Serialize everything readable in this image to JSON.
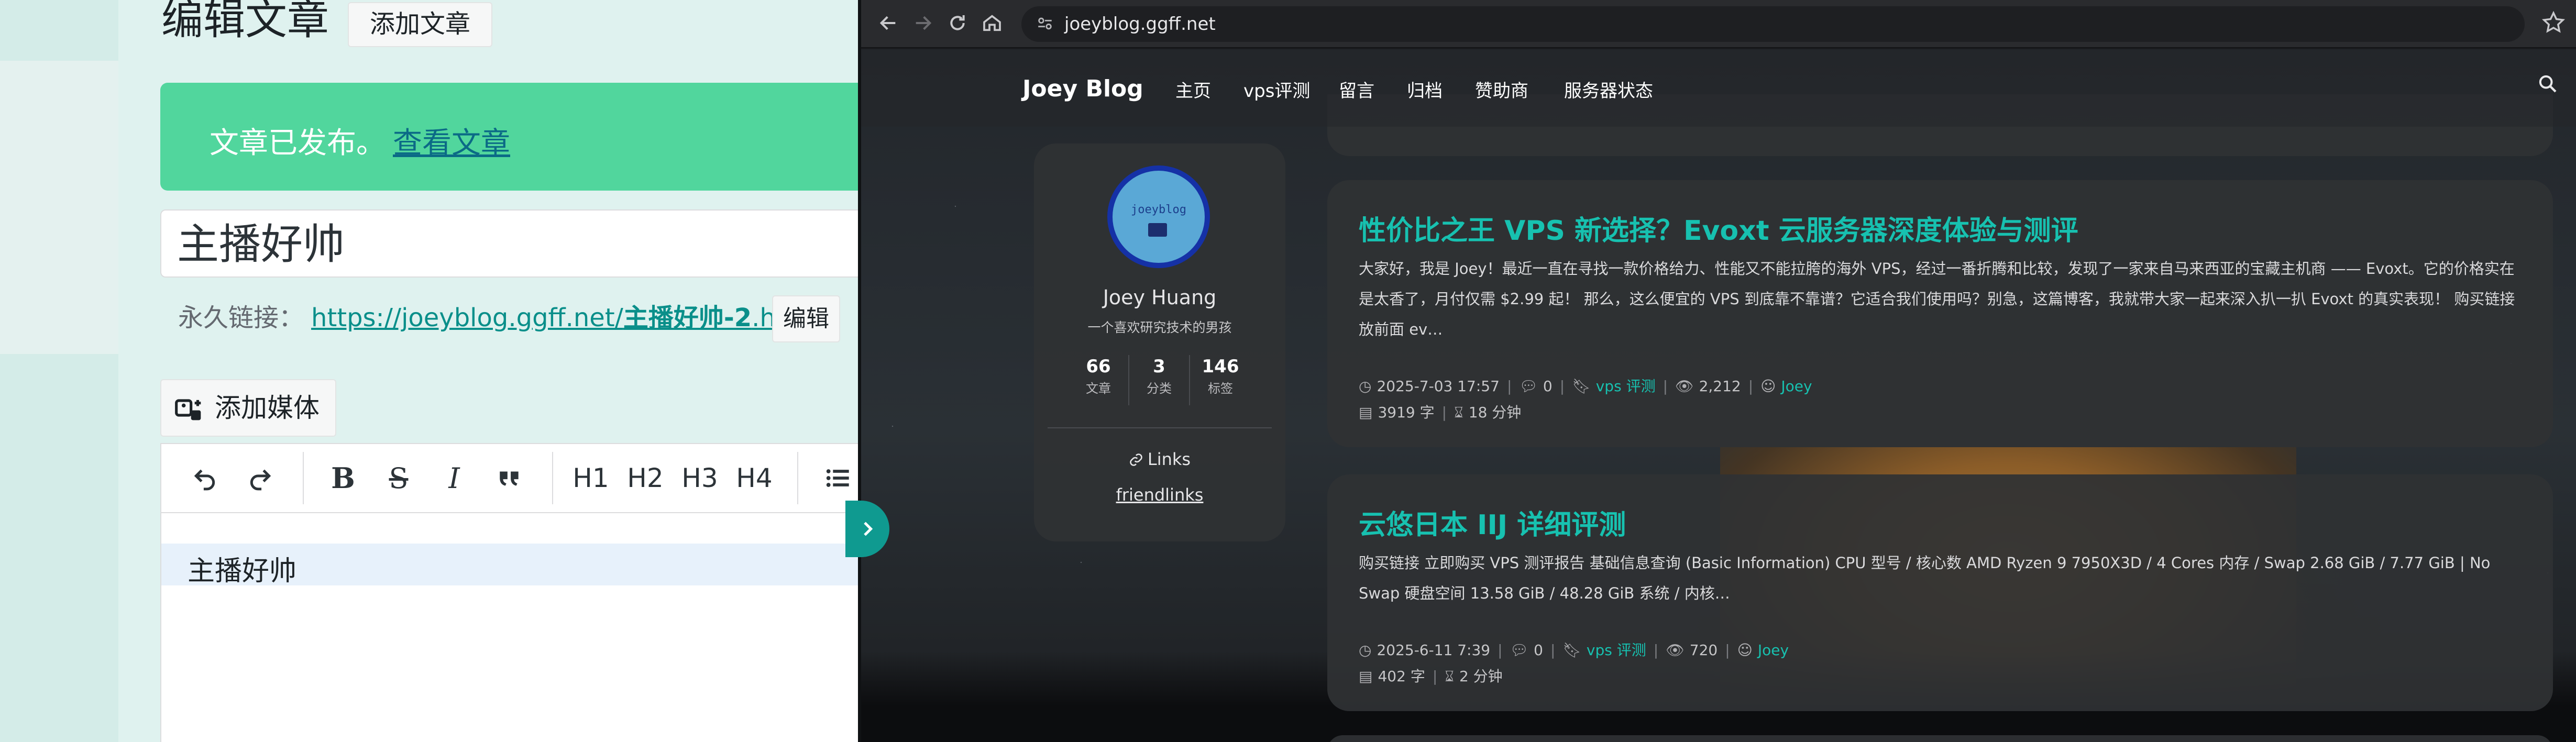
{
  "editor": {
    "heading": "编辑文章",
    "add_post_label": "添加文章",
    "notice_text": "文章已发布。",
    "notice_link": "查看文章",
    "post_title": "主播好帅",
    "permalink_label": "永久链接：",
    "permalink_base": "https://joeyblog.ggff.net/",
    "permalink_slug": "主播好帅-2",
    "permalink_ext": ".html",
    "permalink_edit_label": "编辑",
    "add_media_label": "添加媒体",
    "toolbar": {
      "undo_icon": "undo-icon",
      "redo_icon": "redo-icon",
      "bold": "B",
      "strike": "S",
      "italic": "I",
      "quote_icon": "quote-icon",
      "h1": "H1",
      "h2": "H2",
      "h3": "H3",
      "h4": "H4",
      "list_icon": "list-icon"
    },
    "content_line": "主播好帅"
  },
  "browser": {
    "url": "joeyblog.ggff.net",
    "icons": [
      "back-icon",
      "forward-icon",
      "reload-icon",
      "home-icon",
      "site-info-icon",
      "bookmark-star-icon"
    ]
  },
  "site": {
    "brand": "Joey Blog",
    "nav": [
      "主页",
      "vps评测",
      "留言",
      "归档",
      "赞助商",
      "服务器状态"
    ],
    "search_icon": "search-icon"
  },
  "profile": {
    "avatar_text": "joeyblog",
    "name": "Joey Huang",
    "bio": "一个喜欢研究技术的男孩",
    "stats": [
      {
        "value": "66",
        "label": "文章"
      },
      {
        "value": "3",
        "label": "分类"
      },
      {
        "value": "146",
        "label": "标签"
      }
    ],
    "links_label": "Links",
    "friendlinks_label": "friendlinks"
  },
  "posts": [
    {
      "title": "性价比之王 VPS 新选择？Evoxt 云服务器深度体验与测评",
      "excerpt": "大家好，我是 Joey！最近一直在寻找一款价格给力、性能又不能拉胯的海外 VPS，经过一番折腾和比较，发现了一家来自马来西亚的宝藏主机商 —— Evoxt。它的价格实在是太香了，月付仅需 $2.99 起！ 那么，这么便宜的 VPS 到底靠不靠谱？它适合我们使用吗？别急，这篇博客，我就带大家一起来深入扒一扒 Evoxt 的真实表现！ 购买链接放前面 ev…",
      "date": "2025-7-03 17:57",
      "comments": "0",
      "category": "vps 评测",
      "views": "2,212",
      "author": "Joey",
      "words": "3919 字",
      "read_time": "18 分钟"
    },
    {
      "title": "云悠日本 IIJ 详细评测",
      "excerpt": "购买链接 立即购买 VPS 测评报告 基础信息查询 (Basic Information) CPU 型号 / 核心数 AMD Ryzen 9 7950X3D / 4 Cores 内存 / Swap 2.68 GiB / 7.77 GiB | No Swap 硬盘空间 13.58 GiB / 48.28 GiB 系统 / 内核…",
      "date": "2025-6-11 7:39",
      "comments": "0",
      "category": "vps 评测",
      "views": "720",
      "author": "Joey",
      "words": "402 字",
      "read_time": "2 分钟"
    }
  ],
  "colors": {
    "accent": "#17c1b0",
    "notice_green": "#51d69d",
    "avatar_border": "#1531a6"
  }
}
